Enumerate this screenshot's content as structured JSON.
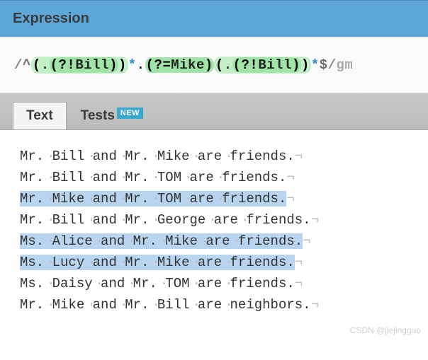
{
  "header": {
    "title": "Expression"
  },
  "regex": {
    "open_delim": "/",
    "anchor_start": "^",
    "grp1_open": "(",
    "dot1": ".",
    "la1_open": "(?!",
    "la1_text": "Bill",
    "la1_close": ")",
    "grp1_close": ")",
    "star1": "*",
    "dot2": ".",
    "la2_open": "(?=",
    "la2_text": "Mike",
    "la2_close": ")",
    "grp3_open": "(",
    "dot3": ".",
    "la3_open": "(?!",
    "la3_text": "Bill",
    "la3_close": ")",
    "grp3_close": ")",
    "star2": "*",
    "anchor_end": "$",
    "close_delim": "/",
    "flags": "gm"
  },
  "tabs": {
    "text": "Text",
    "tests": "Tests",
    "badge": "NEW"
  },
  "lines": [
    {
      "words": [
        "Mr.",
        "Bill",
        "and",
        "Mr.",
        "Mike",
        "are",
        "friends."
      ],
      "match": false
    },
    {
      "words": [
        "Mr.",
        "Bill",
        "and",
        "Mr.",
        "TOM",
        "are",
        "friends."
      ],
      "match": false
    },
    {
      "words": [
        "Mr.",
        "Mike",
        "and",
        "Mr.",
        "TOM",
        "are",
        "friends."
      ],
      "match": true
    },
    {
      "words": [
        "Mr.",
        "Bill",
        "and",
        "Mr.",
        "George",
        "are",
        "friends."
      ],
      "match": false
    },
    {
      "words": [
        "Ms.",
        "Alice",
        "and",
        "Mr.",
        "Mike",
        "are",
        "friends."
      ],
      "match": true
    },
    {
      "words": [
        "Ms.",
        "Lucy",
        "and",
        "Mr.",
        "Mike",
        "are",
        "friends."
      ],
      "match": true
    },
    {
      "words": [
        "Ms.",
        "Daisy",
        "and",
        "Mr.",
        "TOM",
        "are",
        "friends."
      ],
      "match": false
    },
    {
      "words": [
        "Mr.",
        "Mike",
        "and",
        "Mr.",
        "Bill",
        "are",
        "neighbors."
      ],
      "match": false
    }
  ],
  "watermark": "CSDN @jiejingguo"
}
